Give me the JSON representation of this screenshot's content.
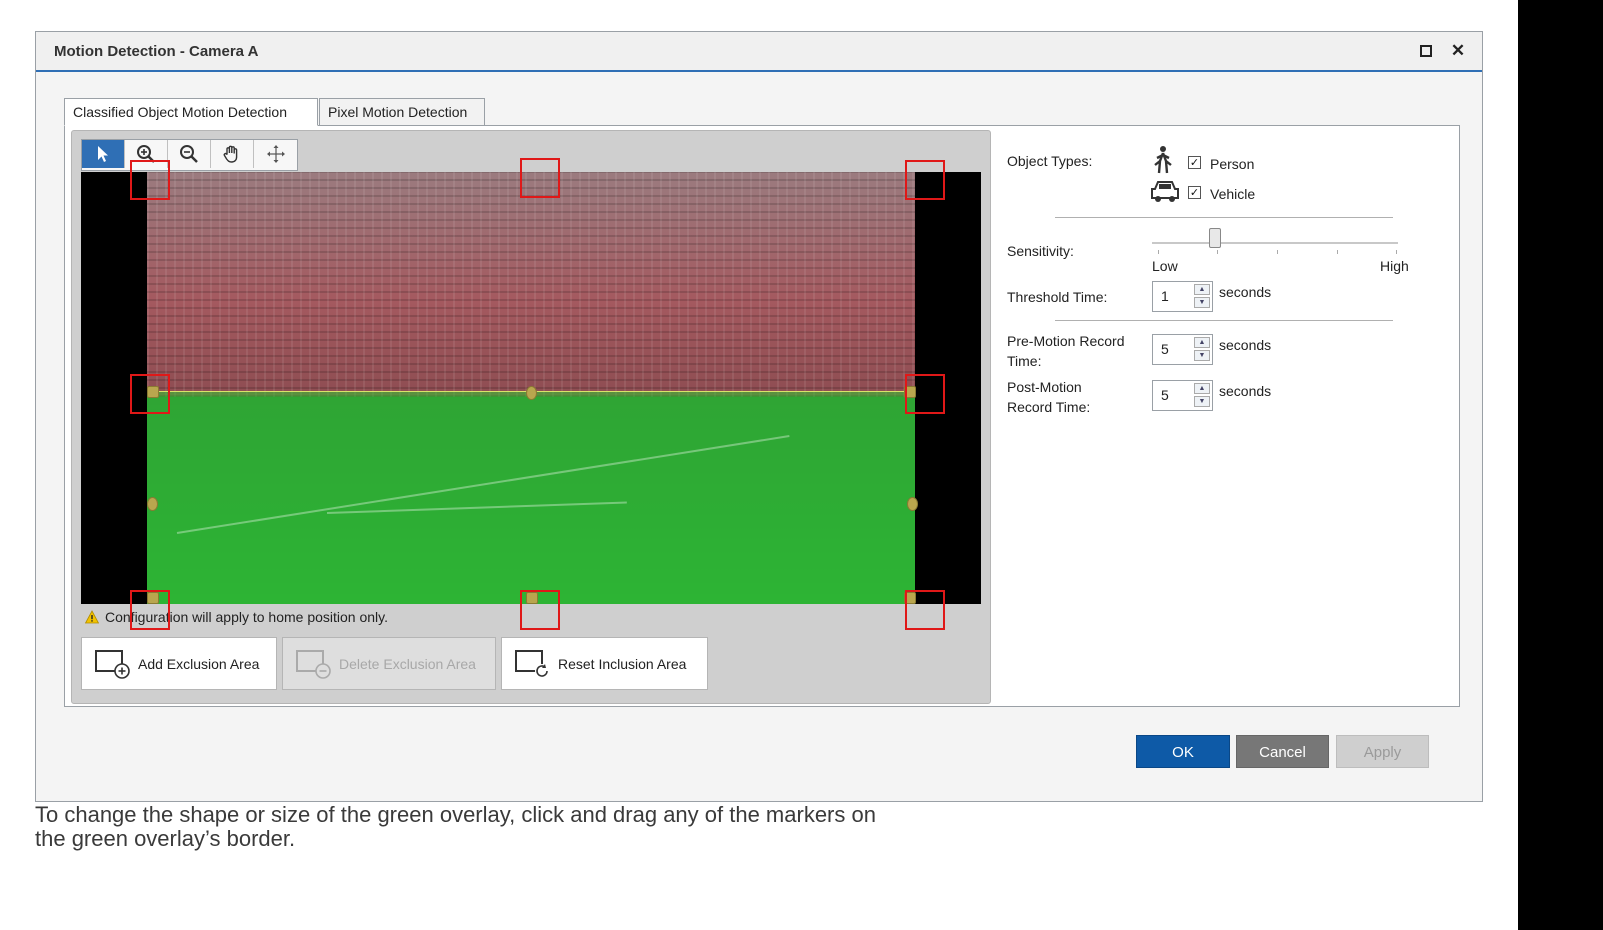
{
  "window": {
    "title": "Motion Detection - Camera A",
    "maximize_icon": "maximize-icon",
    "close_icon": "close-icon",
    "close_glyph": "✕"
  },
  "tabs": [
    {
      "label": "Classified Object Motion Detection",
      "active": true
    },
    {
      "label": "Pixel Motion Detection",
      "active": false
    }
  ],
  "toolbar": {
    "tools": [
      "pointer-icon",
      "zoom-in-icon",
      "zoom-out-icon",
      "pan-hand-icon",
      "move-icon"
    ],
    "active_tool": "pointer-icon",
    "accent": "#2f6fb5"
  },
  "video": {
    "overlay_color": "#30c830",
    "marker_highlight_color": "#e01818"
  },
  "warning": {
    "text": "Configuration will apply to home position only.",
    "icon": "warning-icon"
  },
  "actions": [
    {
      "label": "Add Exclusion Area",
      "enabled": true
    },
    {
      "label": "Delete Exclusion Area",
      "enabled": false
    },
    {
      "label": "Reset Inclusion Area",
      "enabled": true
    }
  ],
  "settings": {
    "object_types_label": "Object Types:",
    "person_label": "Person",
    "person_checked": true,
    "vehicle_label": "Vehicle",
    "vehicle_checked": true,
    "check_glyph": "✓",
    "sensitivity_label": "Sensitivity:",
    "sensitivity_low": "Low",
    "sensitivity_high": "High",
    "threshold_label": "Threshold Time:",
    "threshold_value": "1",
    "pre_motion_label_1": "Pre-Motion Record",
    "pre_motion_label_2": "Time:",
    "pre_motion_value": "5",
    "post_motion_label_1": "Post-Motion",
    "post_motion_label_2": "Record Time:",
    "post_motion_value": "5",
    "seconds": "seconds"
  },
  "buttons": {
    "ok": "OK",
    "cancel": "Cancel",
    "apply": "Apply",
    "ok_color": "#0e5aa7"
  },
  "caption": {
    "line1": "To change the shape or size of the green overlay, click and drag any of the markers on",
    "line2": "the green overlay’s border."
  }
}
